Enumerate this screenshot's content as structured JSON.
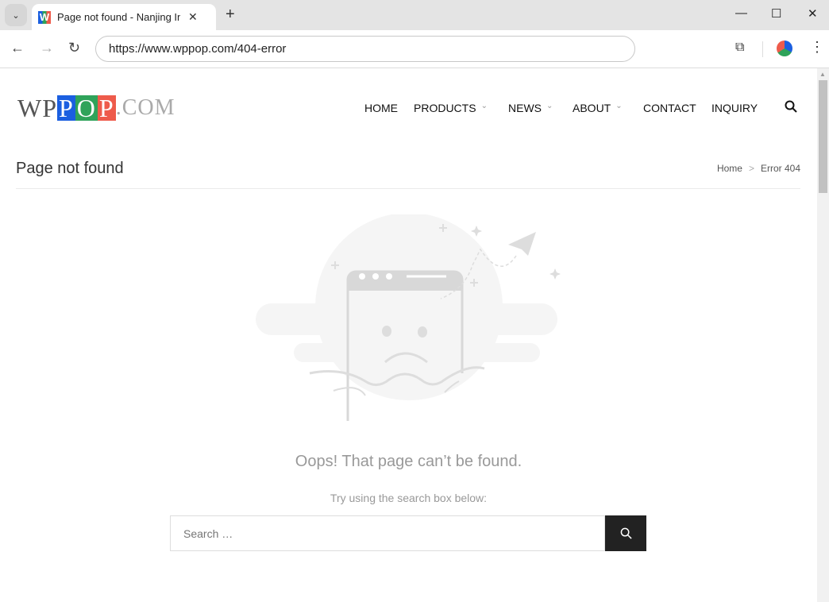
{
  "browser": {
    "tab_title": "Page not found - Nanjing Int",
    "url": "https://www.wppop.com/404-error",
    "favicon_letter": "W"
  },
  "site": {
    "logo": {
      "w": "W",
      "p1": "P",
      "p2": "P",
      "o": "O",
      "p3": "P",
      "com": ".COM"
    },
    "nav": [
      {
        "label": "HOME"
      },
      {
        "label": "PRODUCTS",
        "dropdown": true
      },
      {
        "label": "NEWS",
        "dropdown": true
      },
      {
        "label": "ABOUT",
        "dropdown": true
      },
      {
        "label": "CONTACT"
      },
      {
        "label": "INQUIRY"
      }
    ],
    "page_title": "Page not found",
    "breadcrumb": {
      "home": "Home",
      "sep": ">",
      "current": "Error 404"
    },
    "message": "Oops! That page can’t be found.",
    "hint": "Try using the search box below:",
    "search_placeholder": "Search …"
  },
  "colors": {
    "blue": "#1b5fe0",
    "green": "#2fa35a",
    "red": "#ee5b4b",
    "button": "#222222"
  }
}
